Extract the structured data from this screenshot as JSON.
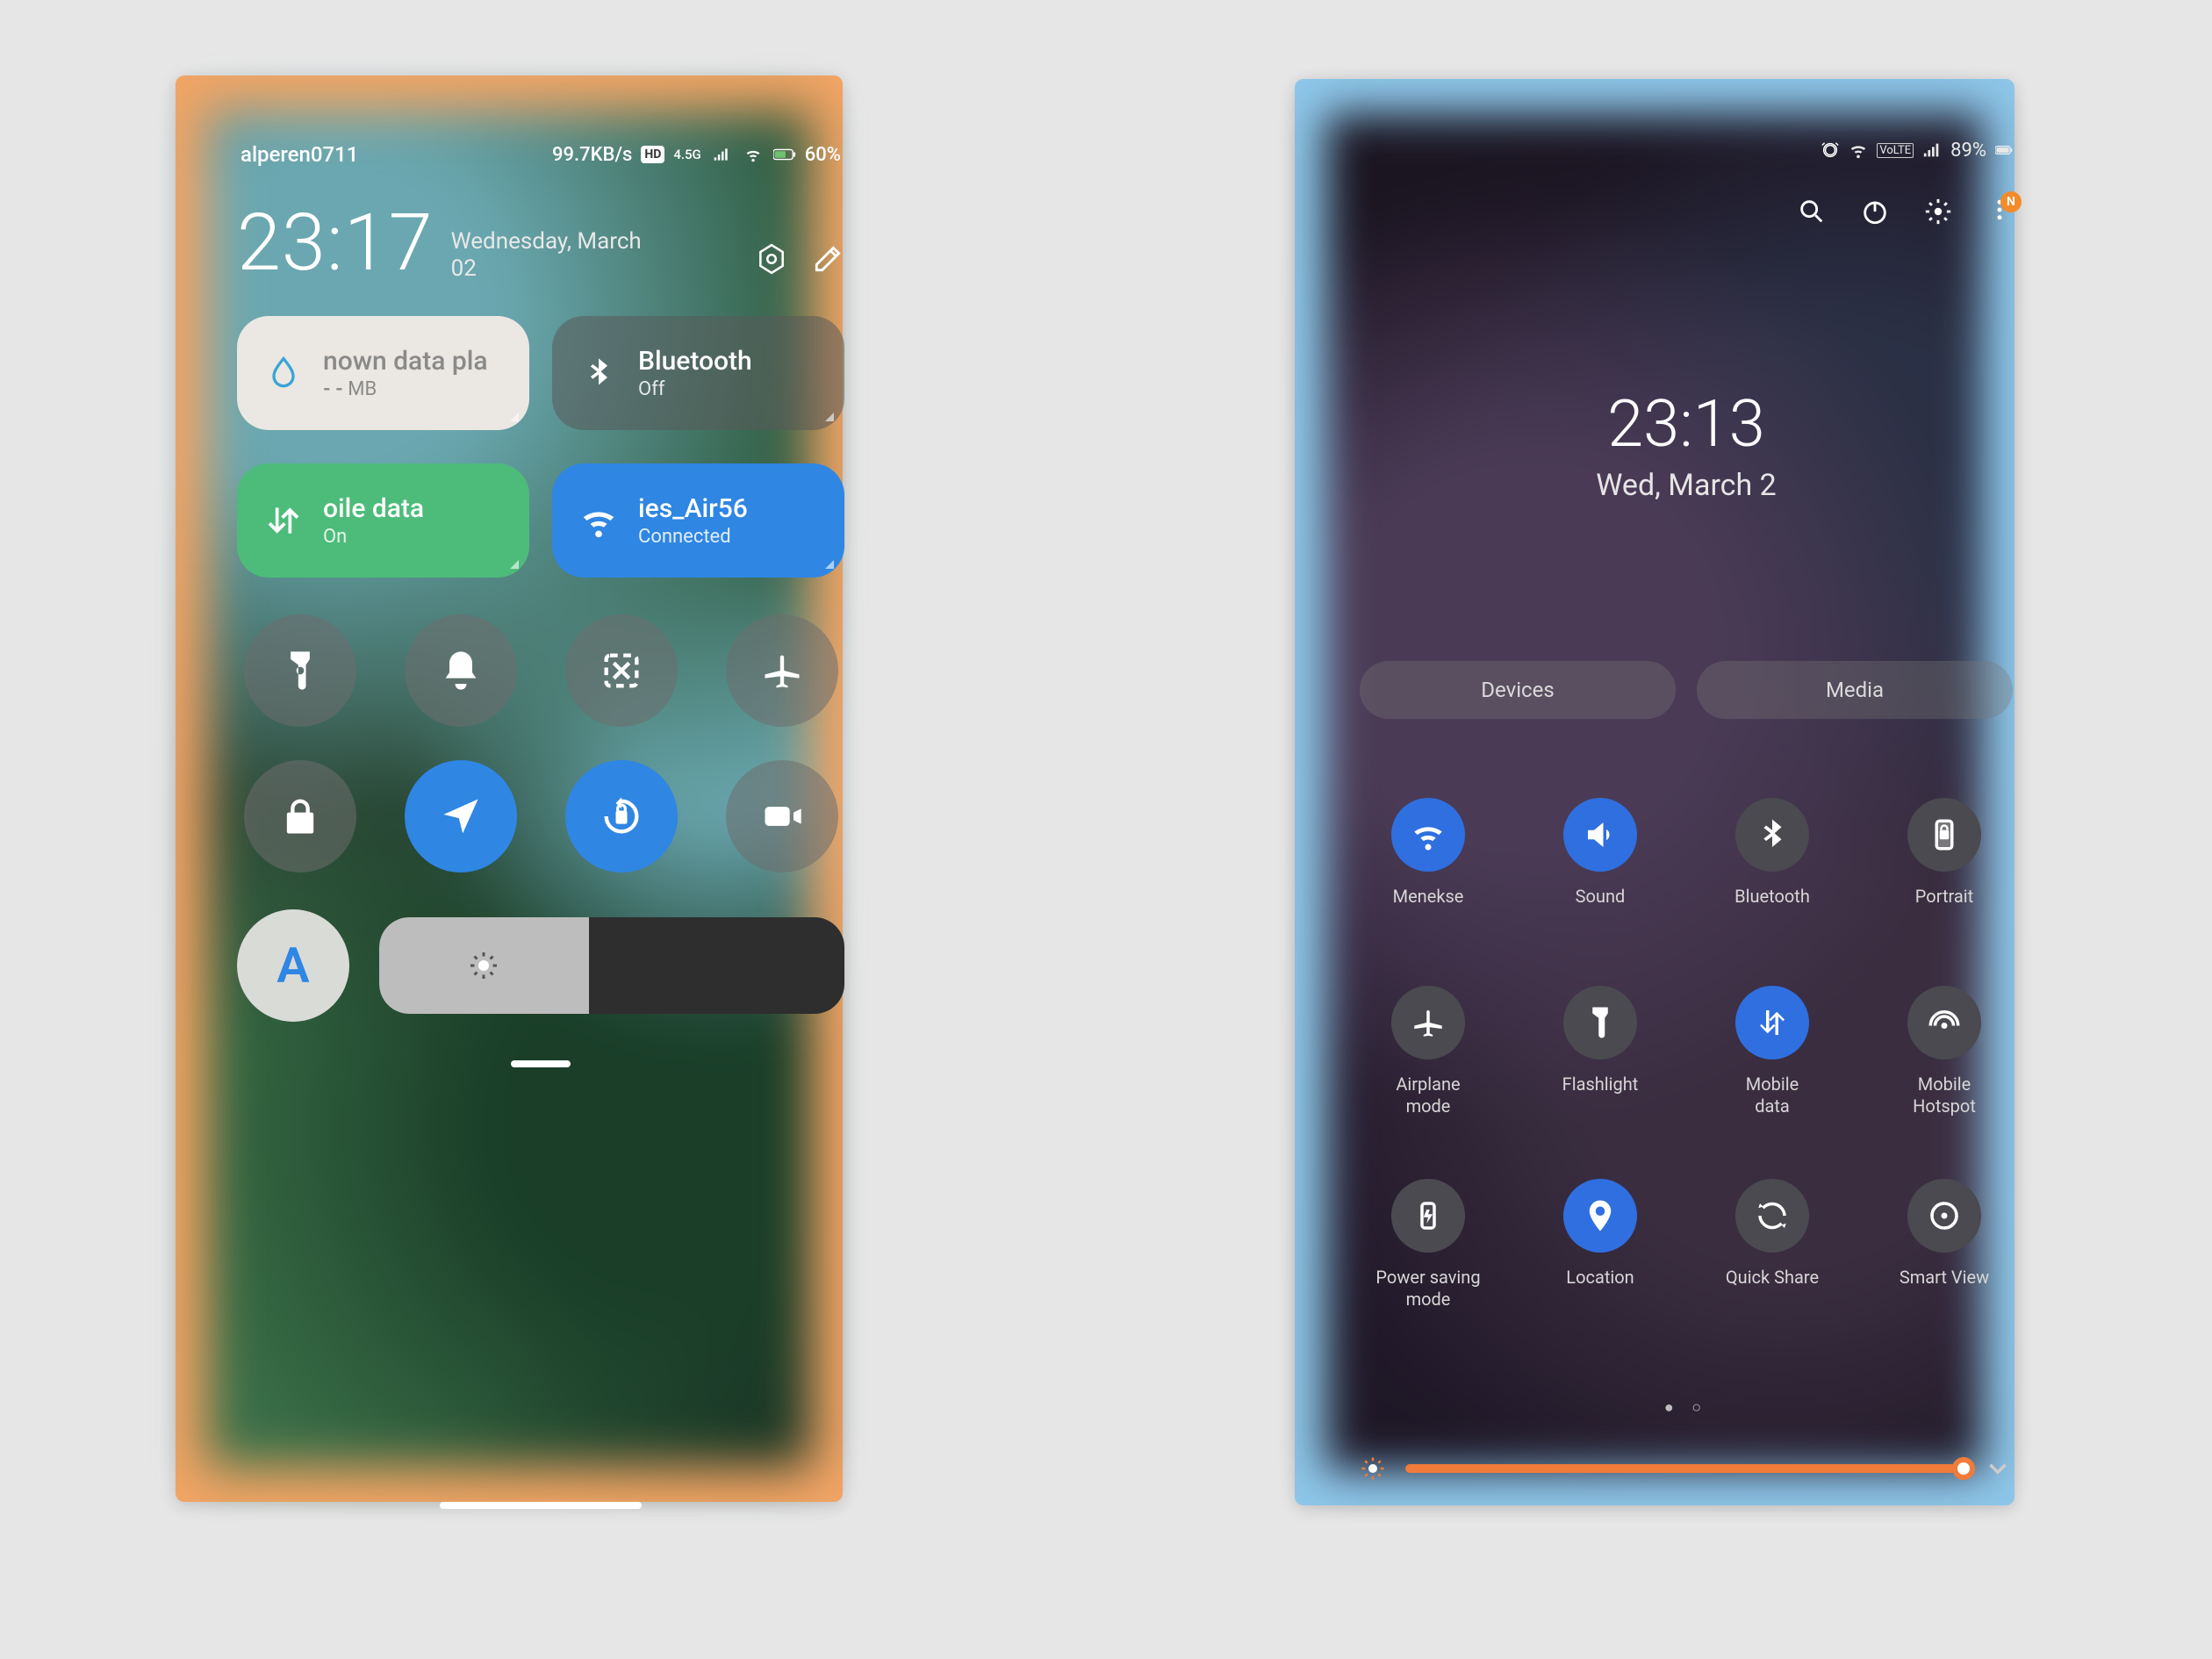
{
  "left": {
    "status": {
      "user": "alperen0711",
      "speed": "99.7KB/s",
      "net_badge": "HD",
      "net_gen": "4.5G",
      "battery": "60%"
    },
    "time": "23:17",
    "date_l1": "Wednesday, March",
    "date_l2": "02",
    "tiles": {
      "data": {
        "title": "nown data pla",
        "sub_prefix": "- -",
        "sub_unit": "MB"
      },
      "bt": {
        "title": "Bluetooth",
        "sub": "Off"
      },
      "mobile": {
        "title": "oile data",
        "sub": "On"
      },
      "wifi": {
        "title": "ies_Air56",
        "sub": "Connected"
      }
    },
    "auto_letter": "A"
  },
  "right": {
    "status": {
      "net_label": "VoLTE",
      "battery": "89%"
    },
    "action_badge": "N",
    "time": "23:13",
    "date": "Wed, March 2",
    "pills": {
      "devices": "Devices",
      "media": "Media"
    },
    "toggles": [
      {
        "label": "Menekse",
        "icon": "wifi",
        "on": true
      },
      {
        "label": "Sound",
        "icon": "sound",
        "on": true
      },
      {
        "label": "Bluetooth",
        "icon": "bluetooth",
        "on": false
      },
      {
        "label": "Portrait",
        "icon": "portrait",
        "on": false
      },
      {
        "label": "Airplane\nmode",
        "icon": "airplane",
        "on": false
      },
      {
        "label": "Flashlight",
        "icon": "flashlight",
        "on": false
      },
      {
        "label": "Mobile\ndata",
        "icon": "mobiledata",
        "on": true
      },
      {
        "label": "Mobile\nHotspot",
        "icon": "hotspot",
        "on": false
      },
      {
        "label": "Power saving\nmode",
        "icon": "powersave",
        "on": false
      },
      {
        "label": "Location",
        "icon": "location",
        "on": true
      },
      {
        "label": "Quick Share",
        "icon": "quickshare",
        "on": false
      },
      {
        "label": "Smart View",
        "icon": "smartview",
        "on": false
      }
    ]
  }
}
